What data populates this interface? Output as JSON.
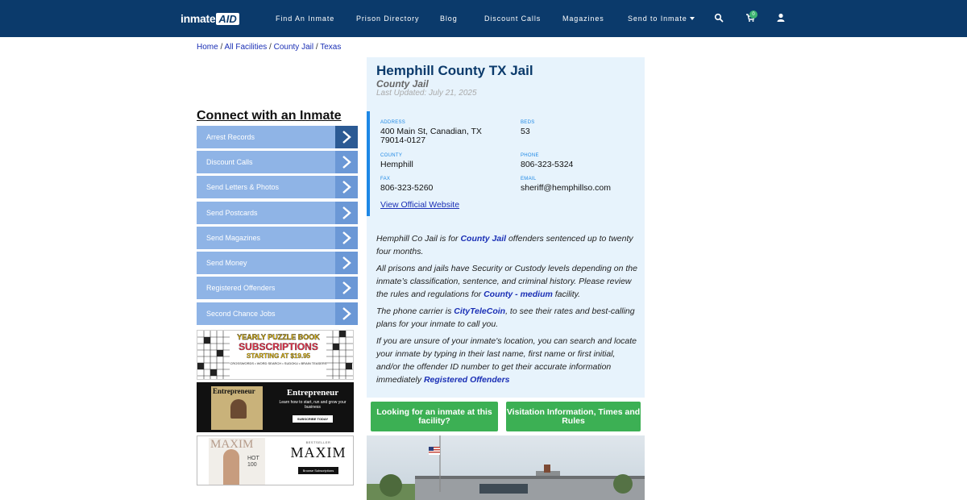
{
  "nav": {
    "logo_part1": "inmate",
    "logo_part2": "AID",
    "links": [
      "Find An Inmate",
      "Prison Directory",
      "Blog",
      "Discount Calls",
      "Magazines",
      "Send to Inmate"
    ],
    "cart_count": "0",
    "icons": [
      "search-icon",
      "cart-icon",
      "user-icon",
      "chevron-down-icon"
    ]
  },
  "breadcrumb": [
    "Home",
    "All Facilities",
    "County Jail",
    "Texas"
  ],
  "sidebar": {
    "title": "Connect with an Inmate",
    "items": [
      "Arrest Records",
      "Discount Calls",
      "Send Letters & Photos",
      "Send Postcards",
      "Send Magazines",
      "Send Money",
      "Registered Offenders",
      "Second Chance Jobs"
    ]
  },
  "ads": {
    "puzzle": {
      "line1": "YEARLY PUZZLE BOOK",
      "line2": "SUBSCRIPTIONS",
      "line3": "STARTING AT $19.95",
      "line4": "CROSSWORDS • WORD SEARCH • SUDOKU • BRAIN TEASERS"
    },
    "entrepreneur": {
      "masthead": "Entrepreneur",
      "logo": "Entrepreneur",
      "tagline": "Learn how to start, run and grow your business",
      "cta": "SUBSCRIBE TODAY"
    },
    "maxim": {
      "masthead": "MAXIM",
      "cover_text": "HOT 100",
      "badge": "BESTSELLER",
      "logo": "MAXIM",
      "cta": "Browse Subscriptions"
    }
  },
  "facility": {
    "title": "Hemphill County TX Jail",
    "type": "County Jail",
    "updated": "Last Updated: July 21, 2025",
    "labels": {
      "address": "ADDRESS",
      "beds": "BEDS",
      "county": "COUNTY",
      "phone": "PHONE",
      "fax": "FAX",
      "email": "EMAIL"
    },
    "address_line1": "400 Main St, Canadian, TX",
    "address_line2": "79014-0127",
    "beds": "53",
    "county": "Hemphill",
    "phone": "806-323-5324",
    "fax": "806-323-5260",
    "email": "sheriff@hemphillso.com",
    "official_link": "View Official Website"
  },
  "paragraphs": {
    "p1_pre": "Hemphill Co Jail is for ",
    "p1_link": "County Jail",
    "p1_post": " offenders sentenced up to twenty four months.",
    "p2_pre": "All prisons and jails have Security or Custody levels depending on the inmate’s classification, sentence, and criminal history. Please review the rules and regulations for ",
    "p2_link": "County - medium",
    "p2_post": " facility.",
    "p3_pre": "The phone carrier is ",
    "p3_link": "CityTeleCoin",
    "p3_post": ", to see their rates and best-calling plans for your inmate to call you.",
    "p4_pre": "If you are unsure of your inmate's location, you can search and locate your inmate by typing in their last name, first name or first initial, and/or the offender ID number to get their accurate information immediately ",
    "p4_link": "Registered Offenders"
  },
  "buttons": {
    "looking": "Looking for an inmate at this facility?",
    "visitation": "Visitation Information, Times and Rules"
  },
  "colors": {
    "nav_bg": "#0b3a6b",
    "panel_bg": "#e7f3fc",
    "accent": "#1e88e5",
    "green": "#3cb054",
    "sidebar_item": "#8fb4e6"
  }
}
